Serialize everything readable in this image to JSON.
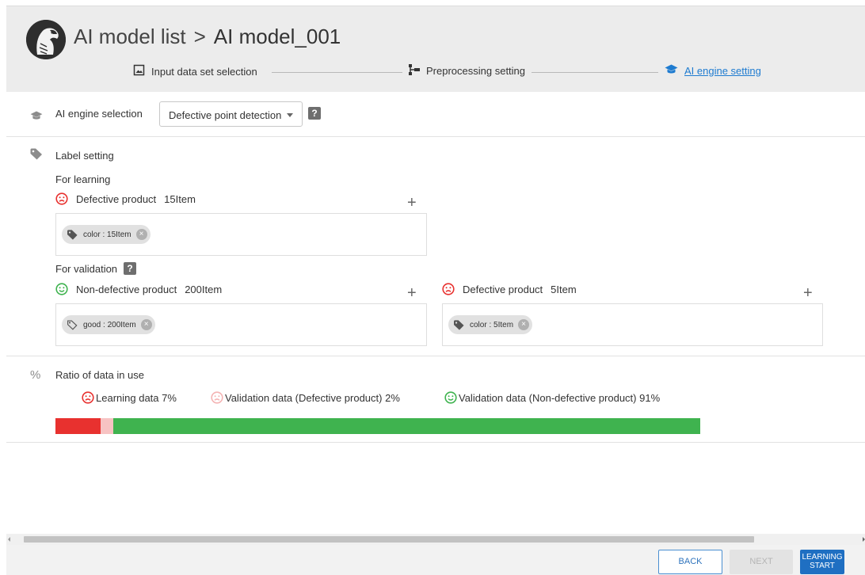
{
  "header": {
    "crumb_root": "AI model list",
    "crumb_sep": ">",
    "crumb_current": "AI model_001",
    "steps": [
      {
        "label": "Input data set selection",
        "icon": "image-icon"
      },
      {
        "label": "Preprocessing setting",
        "icon": "preprocessing-icon"
      },
      {
        "label": "AI engine setting",
        "icon": "graduation-cap-icon",
        "active": true
      }
    ]
  },
  "engine": {
    "label": "AI engine selection",
    "selected": "Defective point detection",
    "help": "?"
  },
  "labels": {
    "title": "Label setting",
    "learning": {
      "heading": "For learning",
      "defective": {
        "label": "Defective product",
        "count": "15Item"
      },
      "chips": [
        {
          "text": "color : 15Item"
        }
      ]
    },
    "validation": {
      "heading": "For validation",
      "help": "?",
      "non_defective": {
        "label": "Non-defective product",
        "count": "200Item",
        "chips": [
          {
            "text": "good : 200Item"
          }
        ]
      },
      "defective": {
        "label": "Defective product",
        "count": "5Item",
        "chips": [
          {
            "text": "color : 5Item"
          }
        ]
      }
    },
    "add": "+",
    "remove": "×"
  },
  "ratio": {
    "icon_text": "%",
    "title": "Ratio of data in use",
    "items": [
      {
        "label": "Learning data 7%",
        "percent": 7,
        "color": "#e8312f"
      },
      {
        "label": "Validation data (Defective product) 2%",
        "percent": 2,
        "color": "#f7c3c3"
      },
      {
        "label": "Validation data (Non-defective product) 91%",
        "percent": 91,
        "color": "#3fb34f"
      }
    ]
  },
  "footer": {
    "back": "BACK",
    "next": "NEXT",
    "learning_start_1": "LEARNING",
    "learning_start_2": "START"
  },
  "colors": {
    "accent": "#1f6fc2",
    "sad": "#e8312f",
    "happy": "#3fb34f",
    "light_sad": "#f7c3c3"
  }
}
